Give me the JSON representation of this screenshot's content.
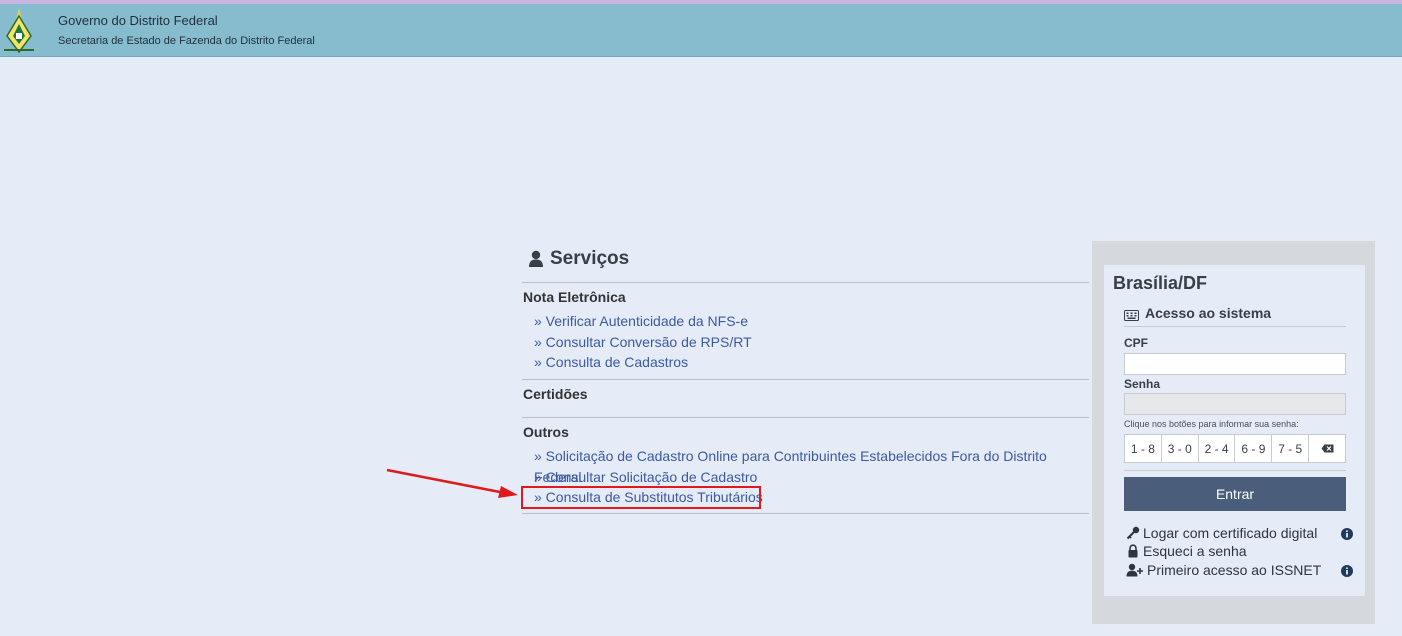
{
  "header": {
    "title": "Governo do Distrito Federal",
    "subtitle": "Secretaria de Estado de Fazenda do Distrito Federal"
  },
  "services": {
    "title": "Serviços",
    "sections": [
      {
        "title": "Nota Eletrônica",
        "links": [
          "» Verificar Autenticidade da NFS-e",
          "» Consultar Conversão de RPS/RT",
          "» Consulta de Cadastros"
        ]
      },
      {
        "title": "Certidões",
        "links": []
      },
      {
        "title": "Outros",
        "links": [
          "» Solicitação de Cadastro Online para Contribuintes Estabelecidos Fora do Distrito Federal",
          "» Consultar Solicitação de Cadastro",
          "» Consulta de Substitutos Tributários"
        ]
      }
    ]
  },
  "login": {
    "city": "Brasília/DF",
    "access_title": "Acesso ao sistema",
    "cpf_label": "CPF",
    "cpf_value": "",
    "password_label": "Senha",
    "password_value": "",
    "hint": "Clique nos botões para informar sua senha:",
    "keys": [
      "1 - 8",
      "3 - 0",
      "2 - 4",
      "6 - 9",
      "7 - 5"
    ],
    "enter_label": "Entrar",
    "options": {
      "certificate": "Logar com certificado digital",
      "forgot": "Esqueci a senha",
      "first_access": "Primeiro acesso ao ISSNET"
    }
  },
  "colors": {
    "header_bg": "#87bccf",
    "page_bg": "#e5ebf7",
    "link": "#3b5aa2",
    "button": "#4a5e7b",
    "highlight": "#e0191c"
  }
}
